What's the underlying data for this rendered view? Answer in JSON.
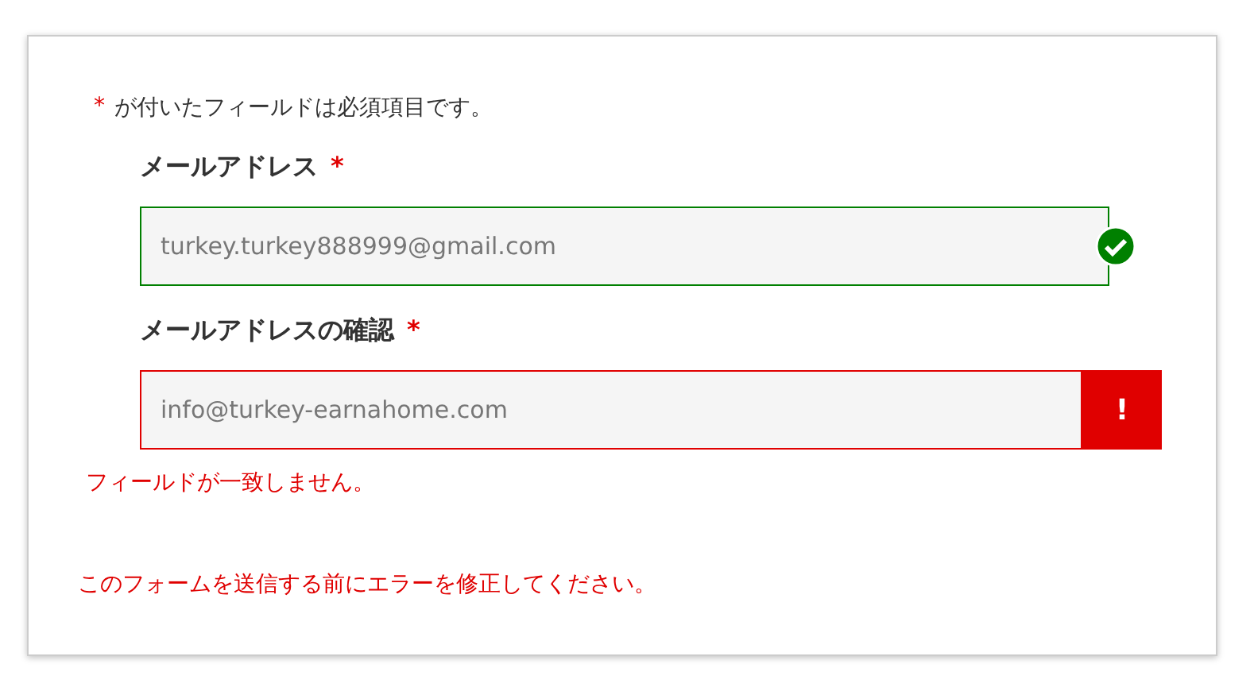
{
  "required_note": {
    "mark": "*",
    "text": "が付いたフィールドは必須項目です。"
  },
  "fields": [
    {
      "label": "メールアドレス",
      "required_mark": "*",
      "value": "turkey.turkey888999@gmail.com",
      "valid": true
    },
    {
      "label": "メールアドレスの確認",
      "required_mark": "*",
      "value": "info@turkey-earnahome.com",
      "valid": false,
      "error_badge": "!",
      "error": "フィールドが一致しません。"
    }
  ],
  "form_error": "このフォームを送信する前にエラーを修正してください。"
}
